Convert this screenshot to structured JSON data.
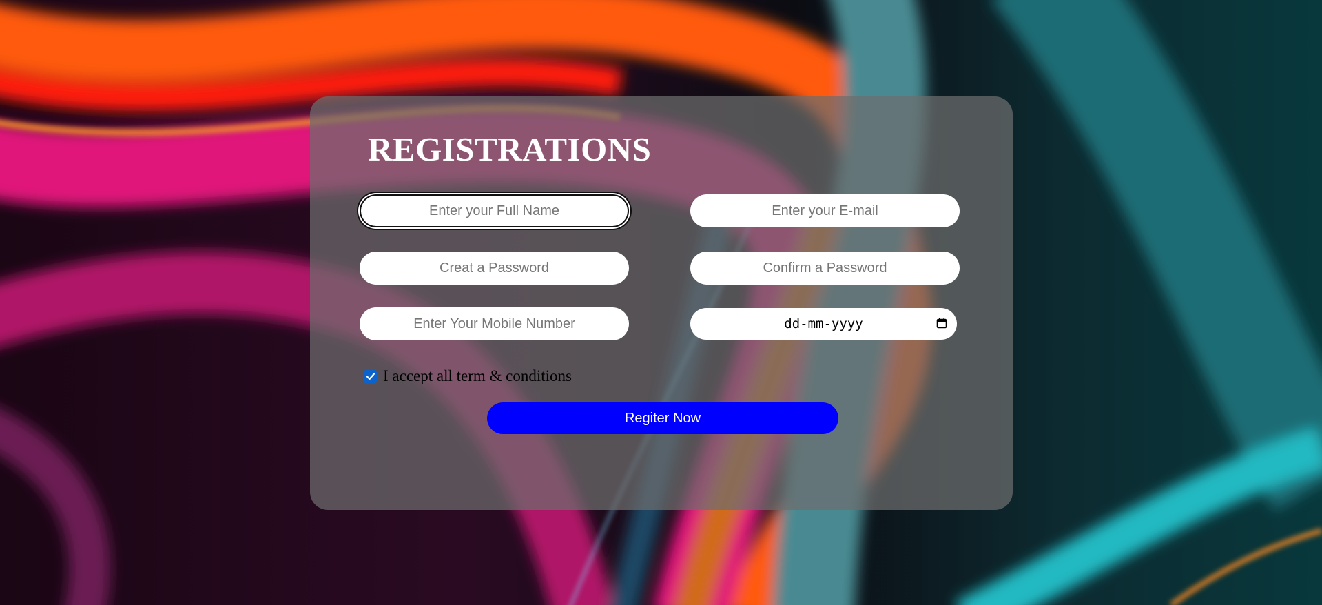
{
  "form": {
    "title": "REGISTRATIONS",
    "full_name_placeholder": "Enter your Full Name",
    "email_placeholder": "Enter your E-mail",
    "password_placeholder": "Creat a Password",
    "confirm_password_placeholder": "Confirm a Password",
    "mobile_placeholder": "Enter Your Mobile Number",
    "date_placeholder": "dd-mm-yyyy",
    "terms_label": "I accept all term & conditions",
    "terms_checked": true,
    "submit_label": "Regiter Now"
  },
  "icons": {
    "date": "calendar-icon",
    "check": "checkmark-icon"
  },
  "colors": {
    "submit_button": "#0000ff",
    "checkbox": "#0b63ce",
    "card_overlay": "rgba(110,110,110,0.72)"
  }
}
